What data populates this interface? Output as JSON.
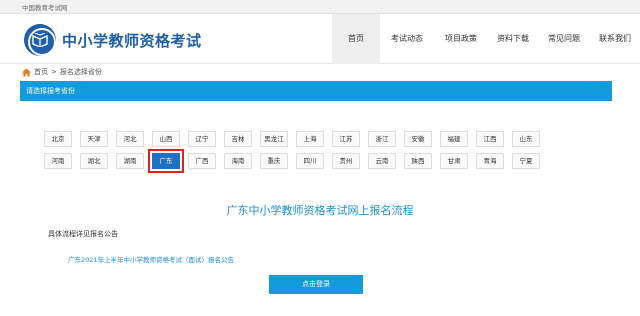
{
  "topbar": {
    "text": "中国教育考试网"
  },
  "header": {
    "site_title": "中小学教师资格考试"
  },
  "nav": [
    {
      "label": "首页",
      "active": true
    },
    {
      "label": "考试动态",
      "active": false
    },
    {
      "label": "项目政策",
      "active": false
    },
    {
      "label": "资料下载",
      "active": false
    },
    {
      "label": "常见问题",
      "active": false
    },
    {
      "label": "联系我们",
      "active": false
    }
  ],
  "breadcrumb": {
    "home": "首页",
    "separator": ">",
    "current": "报名选择省份"
  },
  "panel": {
    "title": "请选择报考省份"
  },
  "provinces": [
    [
      "北京",
      "天津",
      "河北",
      "山西",
      "辽宁",
      "吉林",
      "黑龙江",
      "上海",
      "江苏",
      "浙江",
      "安徽",
      "福建",
      "江西",
      "山东"
    ],
    [
      "河南",
      "湖北",
      "湖南",
      "广东",
      "广西",
      "海南",
      "重庆",
      "四川",
      "贵州",
      "云南",
      "陕西",
      "甘肃",
      "青海",
      "宁夏"
    ]
  ],
  "selected_province": "广东",
  "flow": {
    "title": "广东中小学教师资格考试网上报名流程",
    "subtitle": "具体流程详见报名公告",
    "link": "广东2021年上半年中小学教师资格考试（面试）报名公告",
    "login_button": "点击登录"
  },
  "colors": {
    "brand": "#1f5fa8",
    "accent": "#149bdb",
    "selected": "#1f6fc2",
    "highlight": "#e0201c"
  }
}
